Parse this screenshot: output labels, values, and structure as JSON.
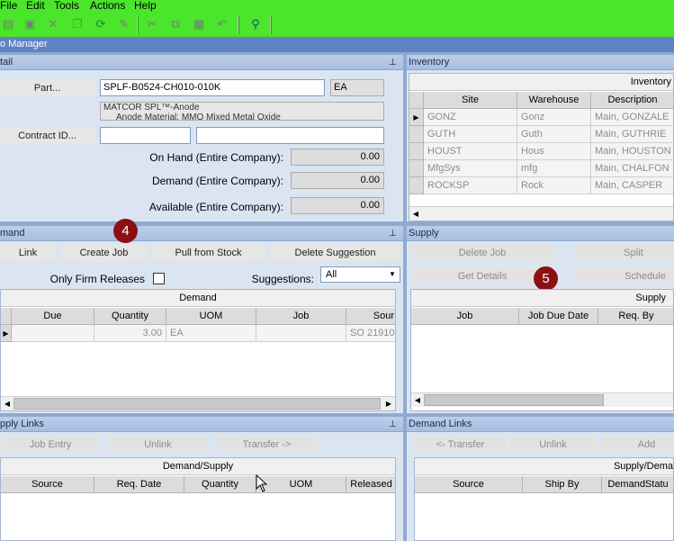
{
  "menu": {
    "file": "File",
    "edit": "Edit",
    "tools": "Tools",
    "actions": "Actions",
    "help": "Help"
  },
  "app_title": "o Manager",
  "detail": {
    "title": "tail",
    "part_button": "Part...",
    "part_value": "SPLF-B0524-CH010-010K",
    "uom_value": "EA",
    "part_desc_line1": "MATCOR SPL™-Anode",
    "part_desc_line2": "Anode Material: MMO Mixed Metal Oxide",
    "contract_button": "Contract ID...",
    "on_hand_label": "On Hand (Entire Company):",
    "on_hand_value": "0.00",
    "demand_label": "Demand (Entire Company):",
    "demand_value": "0.00",
    "available_label": "Available (Entire Company):",
    "available_value": "0.00"
  },
  "inventory": {
    "title": "Inventory",
    "grid_title": "Inventory",
    "columns": [
      "Site",
      "Warehouse",
      "Description"
    ],
    "rows": [
      [
        "GONZ",
        "Gonz",
        "Main, GONZALE"
      ],
      [
        "GUTH",
        "Guth",
        "Main, GUTHRIE"
      ],
      [
        "HOUST",
        "Hous",
        "Main, HOUSTON"
      ],
      [
        "MfgSys",
        "mfg",
        "Main, CHALFON"
      ],
      [
        "ROCKSP",
        "Rock",
        "Main, CASPER"
      ]
    ]
  },
  "demand": {
    "title": "mand",
    "buttons": {
      "link": "Link",
      "create_job": "Create Job",
      "pull_from_stock": "Pull from Stock",
      "delete_suggestion": "Delete Suggestion"
    },
    "only_firm_label": "Only Firm Releases",
    "suggestions_label": "Suggestions:",
    "suggestions_value": "All",
    "grid_title": "Demand",
    "columns": [
      "Due",
      "Quantity",
      "UOM",
      "Job",
      "Sour"
    ],
    "row": [
      "",
      "3.00",
      "EA",
      "",
      "SO 21910"
    ],
    "badge": "4"
  },
  "supply": {
    "title": "Supply",
    "buttons": {
      "delete_job": "Delete Job",
      "split": "Split",
      "get_details": "Get Details",
      "schedule": "Schedule"
    },
    "grid_title": "Supply",
    "columns": [
      "Job",
      "Job Due Date",
      "Req. By"
    ],
    "badge": "5"
  },
  "supply_links": {
    "title": "pply Links",
    "buttons": {
      "job_entry": "Job Entry",
      "unlink": "Unlink",
      "transfer": "Transfer ->"
    },
    "grid_title": "Demand/Supply",
    "columns": [
      "Source",
      "Req. Date",
      "Quantity",
      "UOM",
      "Released"
    ]
  },
  "demand_links": {
    "title": "Demand Links",
    "buttons": {
      "transfer": "<- Transfer",
      "unlink": "Unlink",
      "add": "Add"
    },
    "grid_title": "Supply/Dema",
    "columns": [
      "Source",
      "Ship By",
      "DemandStatu"
    ]
  },
  "colors": {
    "menubar": "#4be52c",
    "badge": "#8c1012",
    "panel": "#dbe5f1"
  }
}
